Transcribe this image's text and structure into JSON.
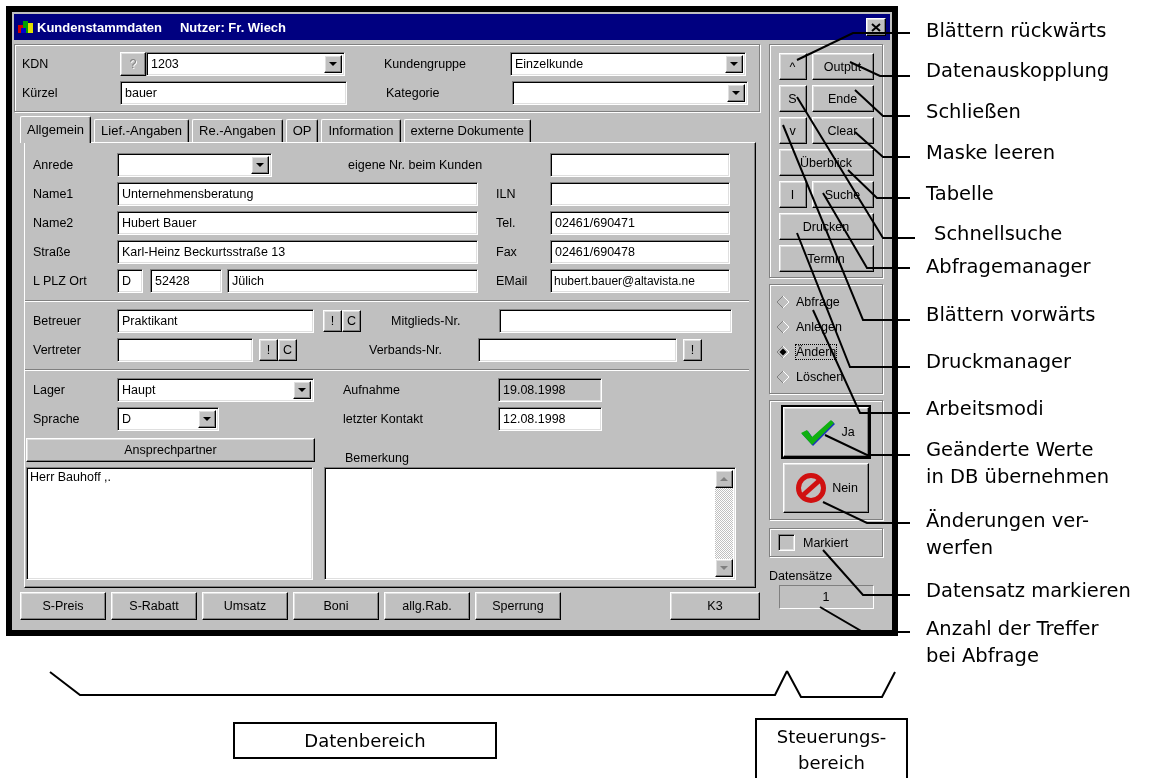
{
  "window": {
    "title": "Kundenstammdaten",
    "user": "Nutzer: Fr. Wiech"
  },
  "header": {
    "kdn_label": "KDN",
    "query_button": {
      "label": "?",
      "disabled": true
    },
    "kdn": "1203",
    "kuerzel_label": "Kürzel",
    "kuerzel": "bauer",
    "kundengruppe_label": "Kundengruppe",
    "kundengruppe": "Einzelkunde",
    "kategorie_label": "Kategorie"
  },
  "tabs": [
    {
      "label": "Allgemein",
      "selected": true
    },
    {
      "label": "Lief.-Angaben",
      "selected": false
    },
    {
      "label": "Re.-Angaben",
      "selected": false
    },
    {
      "label": "OP",
      "selected": false
    },
    {
      "label": "Information",
      "selected": false
    },
    {
      "label": "externe Dokumente",
      "selected": false
    }
  ],
  "general": {
    "anrede_label": "Anrede",
    "eigene_nr_label": "eigene Nr. beim Kunden",
    "name1_label": "Name1",
    "name1": "Unternehmensberatung",
    "iln_label": "ILN",
    "name2_label": "Name2",
    "name2": "Hubert Bauer",
    "tel_label": "Tel.",
    "tel": "02461/690471",
    "strasse_label": "Straße",
    "strasse": "Karl-Heinz Beckurtsstraße 13",
    "fax_label": "Fax",
    "fax": "02461/690478",
    "ort_label": "L PLZ Ort",
    "land": "D",
    "plz": "52428",
    "ort": "Jülich",
    "email_label": "EMail",
    "email": "hubert.bauer@altavista.ne",
    "betreuer_label": "Betreuer",
    "betreuer": "Praktikant",
    "betreuer_buttons": [
      "!",
      "C"
    ],
    "mitglieds_label": "Mitglieds-Nr.",
    "vertreter_label": "Vertreter",
    "vertreter_buttons": [
      "!",
      "C"
    ],
    "verbands_label": "Verbands-Nr.",
    "verbands_button": "!",
    "lager_label": "Lager",
    "lager": "Haupt",
    "aufnahme_label": "Aufnahme",
    "aufnahme": {
      "value": "19.08.1998",
      "disabled": true
    },
    "sprache_label": "Sprache",
    "sprache": "D",
    "kontakt_label": "letzter Kontakt",
    "kontakt": "12.08.1998",
    "ansprechpartner_button": "Ansprechpartner",
    "ansprechpartner": [
      "Herr Bauhoff ,."
    ],
    "bemerkung_label": "Bemerkung"
  },
  "bottom_buttons": [
    "S-Preis",
    "S-Rabatt",
    "Umsatz",
    "Boni",
    "allg.Rab.",
    "Sperrung",
    "K3"
  ],
  "control_rows": [
    [
      "^",
      "Output"
    ],
    [
      "S",
      "Ende"
    ],
    [
      "v",
      "Clear"
    ],
    [
      "Überblick"
    ],
    [
      "I",
      "Suche"
    ],
    [
      "Drucken"
    ],
    [
      "Termin"
    ]
  ],
  "modes": [
    {
      "label": "Abfrage",
      "selected": false
    },
    {
      "label": "Anlegen",
      "selected": false
    },
    {
      "label": "Ändern",
      "selected": true
    },
    {
      "label": "Löschen",
      "selected": false
    }
  ],
  "confirm": {
    "ok": {
      "label": "Ja",
      "default": true
    },
    "cancel": "Nein"
  },
  "markiert": {
    "label": "Markiert",
    "checked": false
  },
  "datensaetze": {
    "label": "Datensätze",
    "count": "1"
  },
  "annotations": [
    {
      "lines": [
        "Blättern rückwärts"
      ]
    },
    {
      "lines": [
        "Datenauskopplung"
      ]
    },
    {
      "lines": [
        "Schließen"
      ]
    },
    {
      "lines": [
        "Maske leeren"
      ]
    },
    {
      "lines": [
        "Tabelle"
      ]
    },
    {
      "lines": [
        "Schnellsuche"
      ]
    },
    {
      "lines": [
        "Abfragemanager"
      ]
    },
    {
      "lines": [
        "Blättern vorwärts"
      ]
    },
    {
      "lines": [
        "Druckmanager"
      ]
    },
    {
      "lines": [
        "Arbeitsmodi"
      ]
    },
    {
      "lines": [
        "Geänderte Werte",
        "in DB übernehmen"
      ]
    },
    {
      "lines": [
        "Änderungen ver-",
        "werfen"
      ]
    },
    {
      "lines": [
        "Datensatz markieren"
      ]
    },
    {
      "lines": [
        "Anzahl der Treffer",
        "bei Abfrage"
      ]
    }
  ],
  "areas": [
    {
      "lines": [
        "Datenbereich"
      ]
    },
    {
      "lines": [
        "Steuerungs-",
        "bereich"
      ]
    }
  ]
}
